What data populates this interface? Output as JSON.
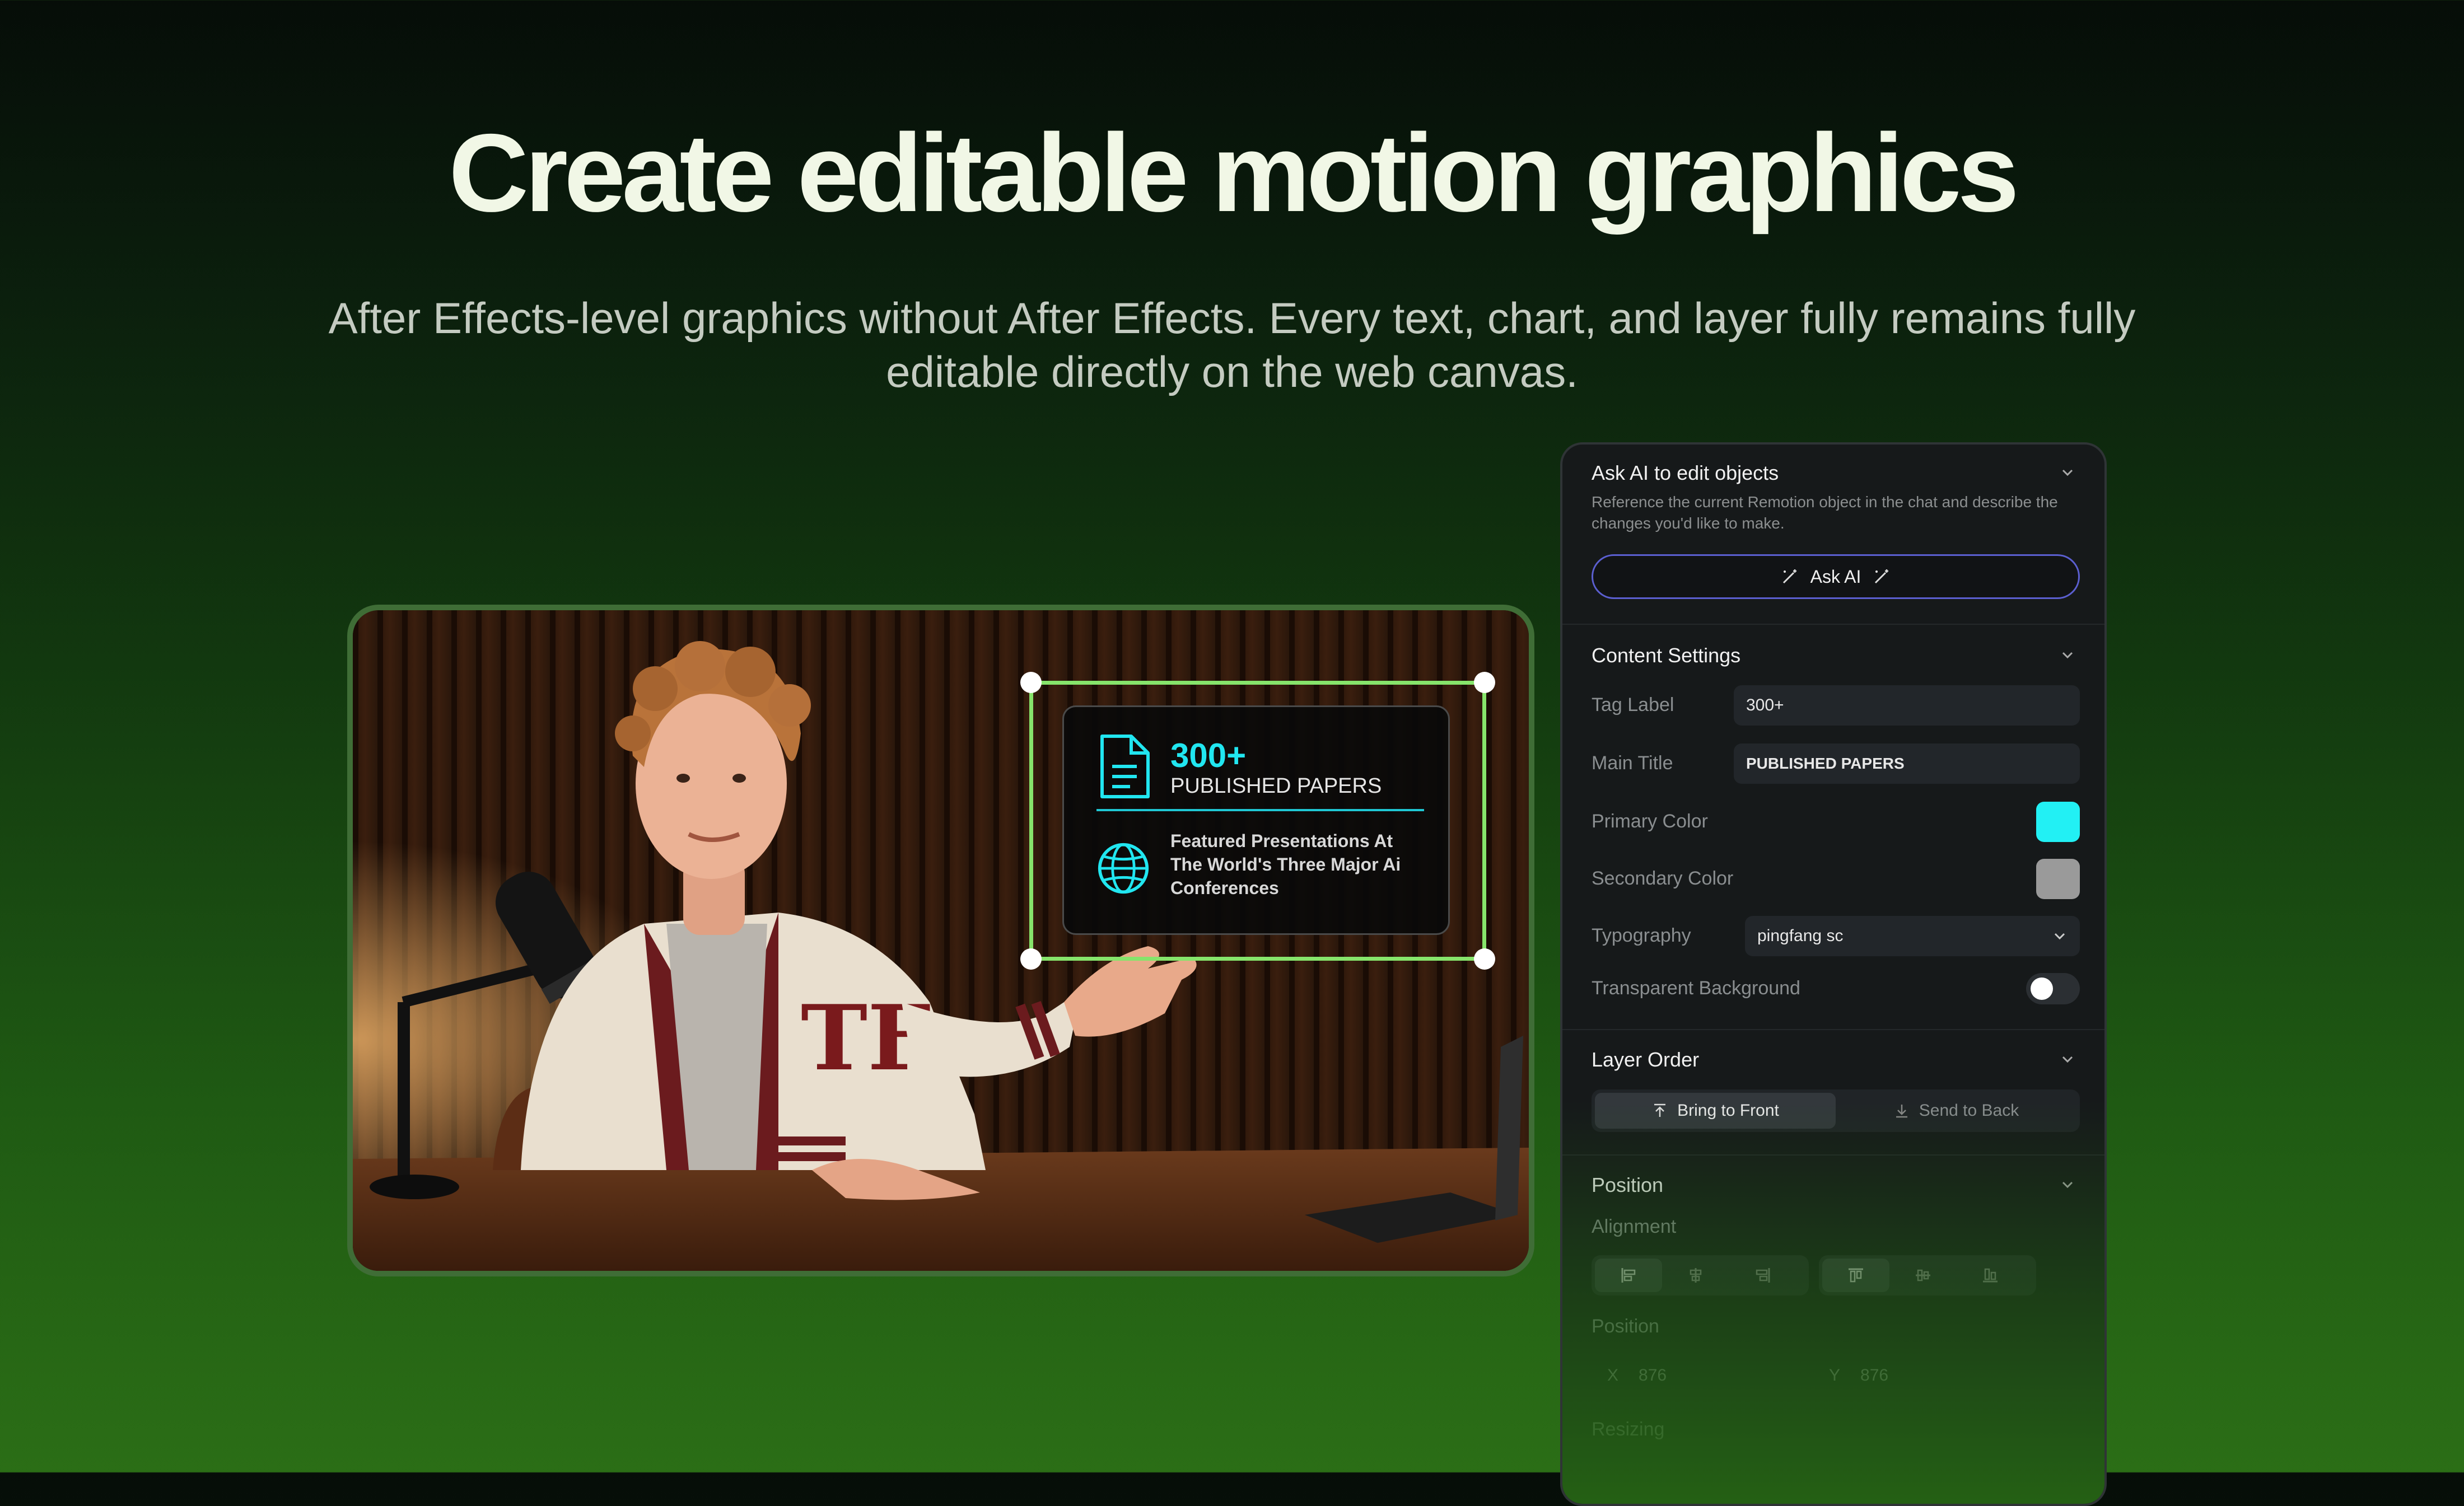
{
  "hero": {
    "title": "Create editable motion graphics",
    "subtitle": "After Effects-level graphics without After Effects. Every text, chart, and layer fully remains fully editable directly on the web canvas."
  },
  "overlay_card": {
    "number": "300+",
    "title": "PUBLISHED PAPERS",
    "description": "Featured Presentations At The World's Three Major Ai Conferences",
    "accent_color": "#21e6f0",
    "selection_color": "#86e46b"
  },
  "panel": {
    "ask_ai": {
      "title": "Ask AI to edit objects",
      "description": "Reference the current Remotion object in the chat and describe the changes you'd like to make.",
      "button_label": "Ask AI"
    },
    "content_settings": {
      "title": "Content Settings",
      "tag_label": {
        "label": "Tag Label",
        "value": "300+"
      },
      "main_title": {
        "label": "Main Title",
        "value": "PUBLISHED PAPERS"
      },
      "primary_color": {
        "label": "Primary Color",
        "value": "#22f0f4"
      },
      "secondary_color": {
        "label": "Secondary Color",
        "value": "#9a9a9a"
      },
      "typography": {
        "label": "Typography",
        "value": "pingfang sc"
      },
      "transparent_bg": {
        "label": "Transparent Background",
        "enabled": false
      }
    },
    "layer_order": {
      "title": "Layer Order",
      "bring_front": "Bring to Front",
      "send_back": "Send to Back"
    },
    "position": {
      "title": "Position",
      "alignment_label": "Alignment",
      "position_label": "Position",
      "x_label": "X",
      "x_value": "876",
      "y_label": "Y",
      "y_value": "876",
      "resizing_label": "Resizing"
    }
  }
}
